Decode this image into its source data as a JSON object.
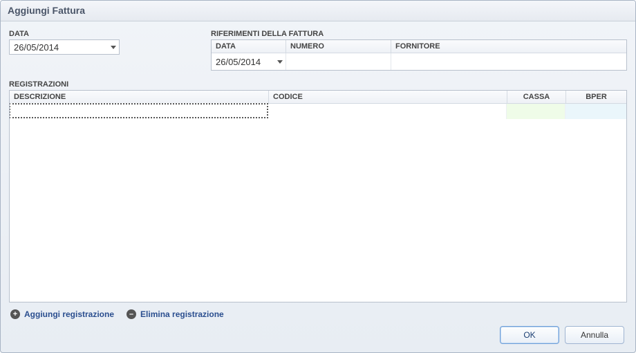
{
  "window": {
    "title": "Aggiungi Fattura"
  },
  "data": {
    "label": "DATA",
    "value": "26/05/2014"
  },
  "riferimenti": {
    "label": "RIFERIMENTI DELLA FATTURA",
    "columns": {
      "data": "DATA",
      "numero": "NUMERO",
      "fornitore": "FORNITORE"
    },
    "row": {
      "data": "26/05/2014",
      "numero": "",
      "fornitore": ""
    }
  },
  "registrazioni": {
    "label": "REGISTRAZIONI",
    "columns": {
      "descrizione": "DESCRIZIONE",
      "codice": "CODICE",
      "cassa": "CASSA",
      "bper": "BPER"
    },
    "rows": [
      {
        "descrizione": "",
        "codice": "",
        "cassa": "",
        "bper": ""
      }
    ]
  },
  "actions": {
    "add": "Aggiungi registrazione",
    "delete": "Elimina registrazione"
  },
  "buttons": {
    "ok": "OK",
    "cancel": "Annulla"
  }
}
